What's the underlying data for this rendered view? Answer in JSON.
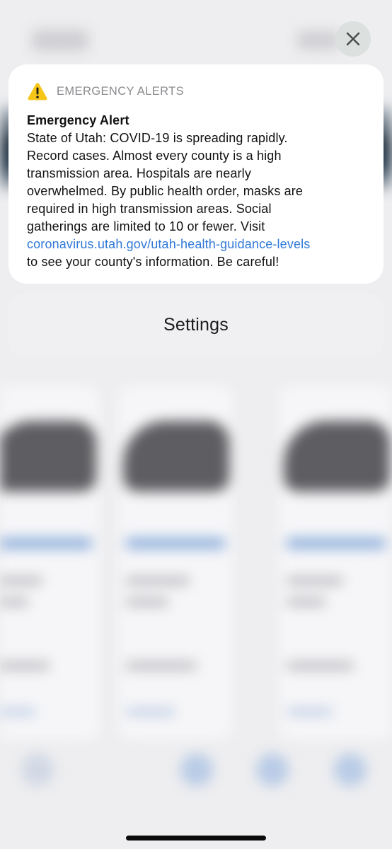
{
  "close_button": {
    "icon": "close-icon"
  },
  "alert": {
    "icon": "warning-icon",
    "icon_color": "#f5c518",
    "app_name": "EMERGENCY ALERTS",
    "title": "Emergency Alert",
    "body": "State of Utah: COVID-19 is spreading rapidly.\nRecord cases. Almost every county is a high\ntransmission area. Hospitals are nearly\noverwhelmed. By public health order, masks are\nrequired in high transmission areas. Social\ngatherings are limited to 10 or fewer. Visit",
    "link": "coronavirus.utah.gov/utah-health-guidance-levels",
    "link_color": "#2f78d8",
    "body_tail": "to see your county's information. Be careful!"
  },
  "settings_button": {
    "label": "Settings"
  }
}
